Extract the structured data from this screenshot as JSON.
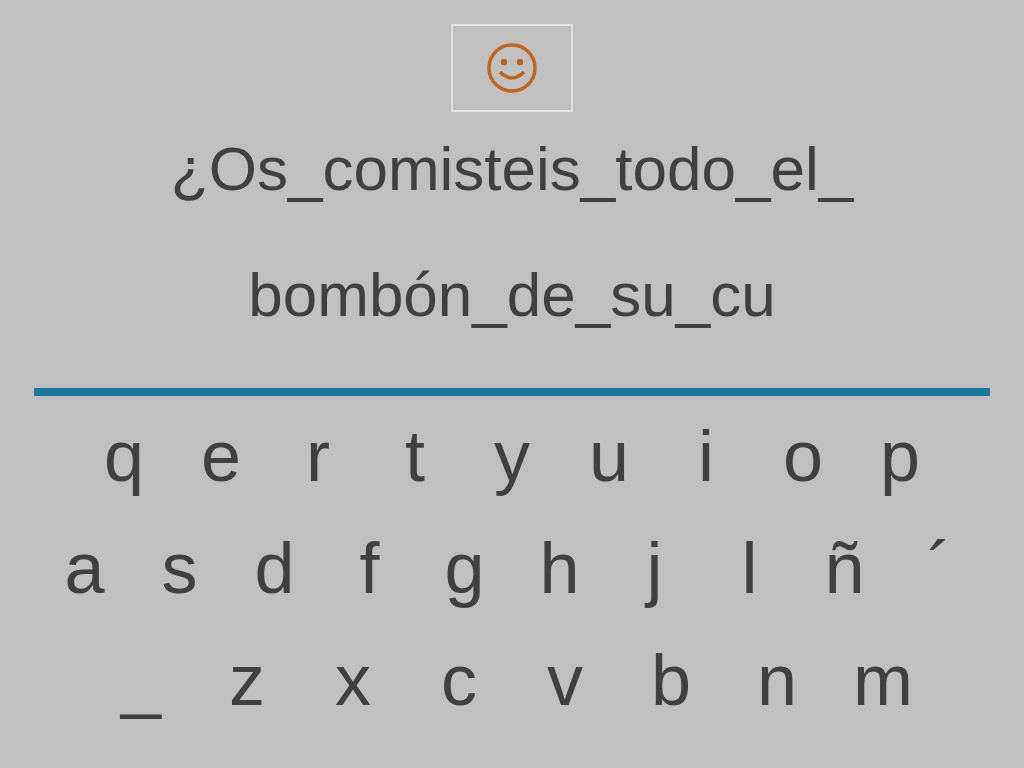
{
  "prompt_lines": [
    "¿Os_comisteis_todo_el_",
    "bombón_de_su_cu"
  ],
  "keyboard_rows": [
    [
      "q",
      "e",
      "r",
      "t",
      "y",
      "u",
      "i",
      "o",
      "p"
    ],
    [
      "a",
      "s",
      "d",
      "f",
      "g",
      "h",
      "j",
      "l",
      "ñ",
      "´"
    ],
    [
      "_",
      "z",
      "x",
      "c",
      "v",
      "b",
      "n",
      "m"
    ]
  ]
}
